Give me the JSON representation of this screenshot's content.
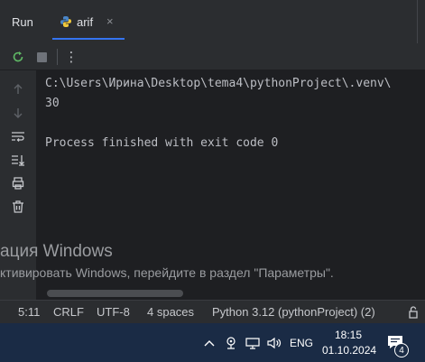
{
  "run_panel": {
    "title": "Run",
    "tab": {
      "label": "arif",
      "close": "×",
      "icon": "python-icon"
    }
  },
  "toolbar": {
    "rerun_icon": "rerun-icon",
    "stop_icon": "stop-icon",
    "more": "⋮"
  },
  "gutter": {
    "icons": [
      "arrow-up-icon",
      "arrow-down-icon",
      "soft-wrap-icon",
      "scroll-to-end-icon",
      "print-icon",
      "trash-icon"
    ]
  },
  "console": {
    "lines": [
      "C:\\Users\\Ирина\\Desktop\\tema4\\pythonProject\\.venv\\",
      "30",
      "",
      "Process finished with exit code 0"
    ]
  },
  "watermark": {
    "line1": "ация Windows",
    "line2": "ктивировать Windows, перейдите в раздел \"Параметры\"."
  },
  "statusbar": {
    "position": "5:11",
    "line_separator": "CRLF",
    "encoding": "UTF-8",
    "indent": "4 spaces",
    "interpreter": "Python 3.12 (pythonProject) (2)",
    "lock_icon": "lock-icon"
  },
  "taskbar": {
    "language": "ENG",
    "time": "18:15",
    "date": "01.10.2024",
    "notification_count": "4",
    "accent": "#1a2b45"
  }
}
